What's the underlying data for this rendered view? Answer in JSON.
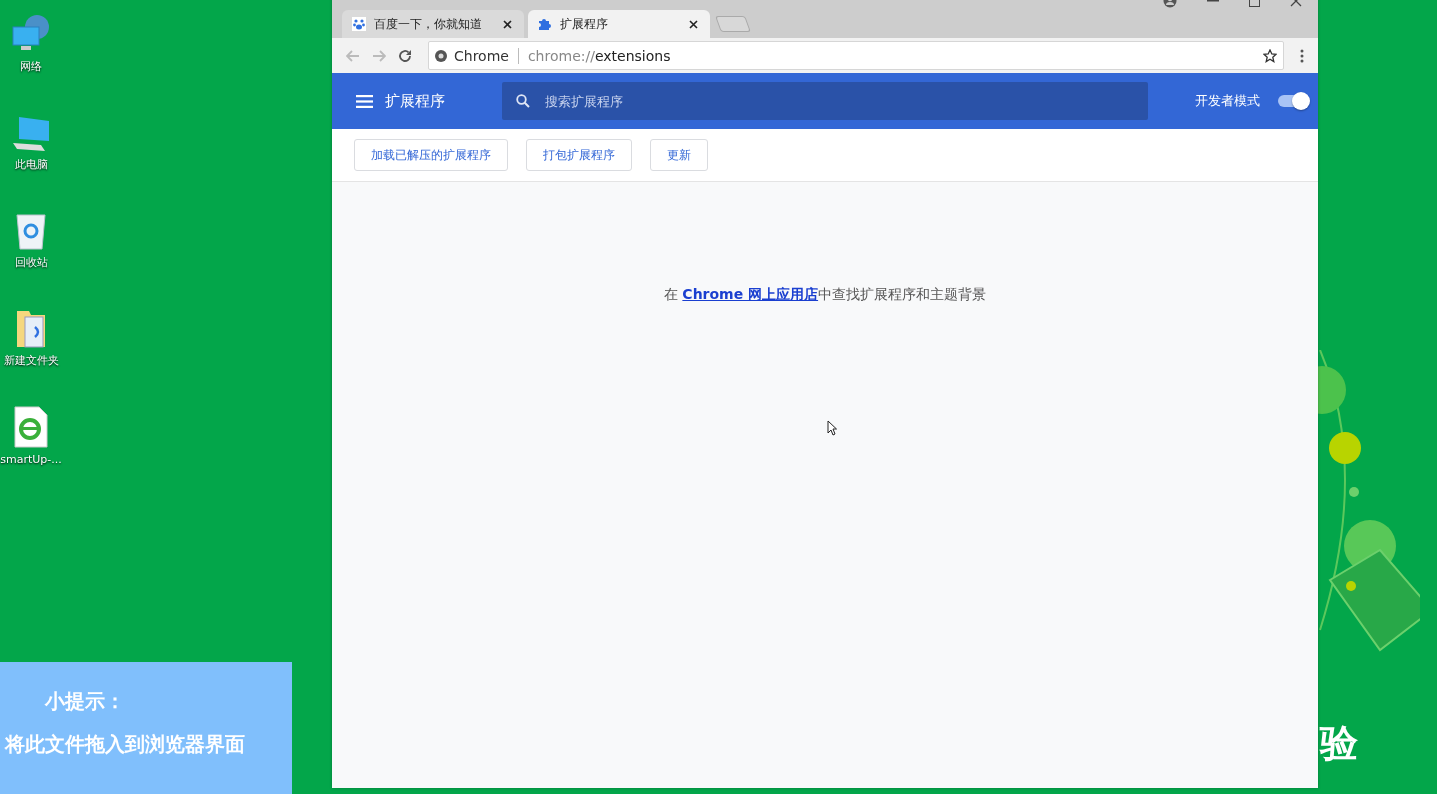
{
  "desktop": {
    "icons": [
      {
        "kind": "network",
        "label": "网络"
      },
      {
        "kind": "computer",
        "label": "此电脑"
      },
      {
        "kind": "recycle",
        "label": "回收站"
      },
      {
        "kind": "folder",
        "label": "新建文件夹"
      },
      {
        "kind": "document",
        "label": "smartUp-..."
      }
    ],
    "wallpaper_text": "验"
  },
  "browser": {
    "tabs": [
      {
        "kind": "baidu",
        "title": "百度一下，你就知道",
        "selected": false
      },
      {
        "kind": "extension",
        "title": "扩展程序",
        "selected": true
      }
    ],
    "address": {
      "origin": "Chrome",
      "url_scheme": "chrome://",
      "url_path": "extensions"
    },
    "header": {
      "title": "扩展程序",
      "search_placeholder": "搜索扩展程序",
      "developer_mode": {
        "label": "开发者模式",
        "on": true
      }
    },
    "buttons": [
      "加载已解压的扩展程序",
      "打包扩展程序",
      "更新"
    ],
    "message": {
      "prefix": "在 ",
      "link": "Chrome 网上应用店",
      "suffix": "中查找扩展程序和主题背景"
    }
  },
  "tip": {
    "title": "小提示：",
    "text": "将此文件拖入到浏览器界面"
  }
}
